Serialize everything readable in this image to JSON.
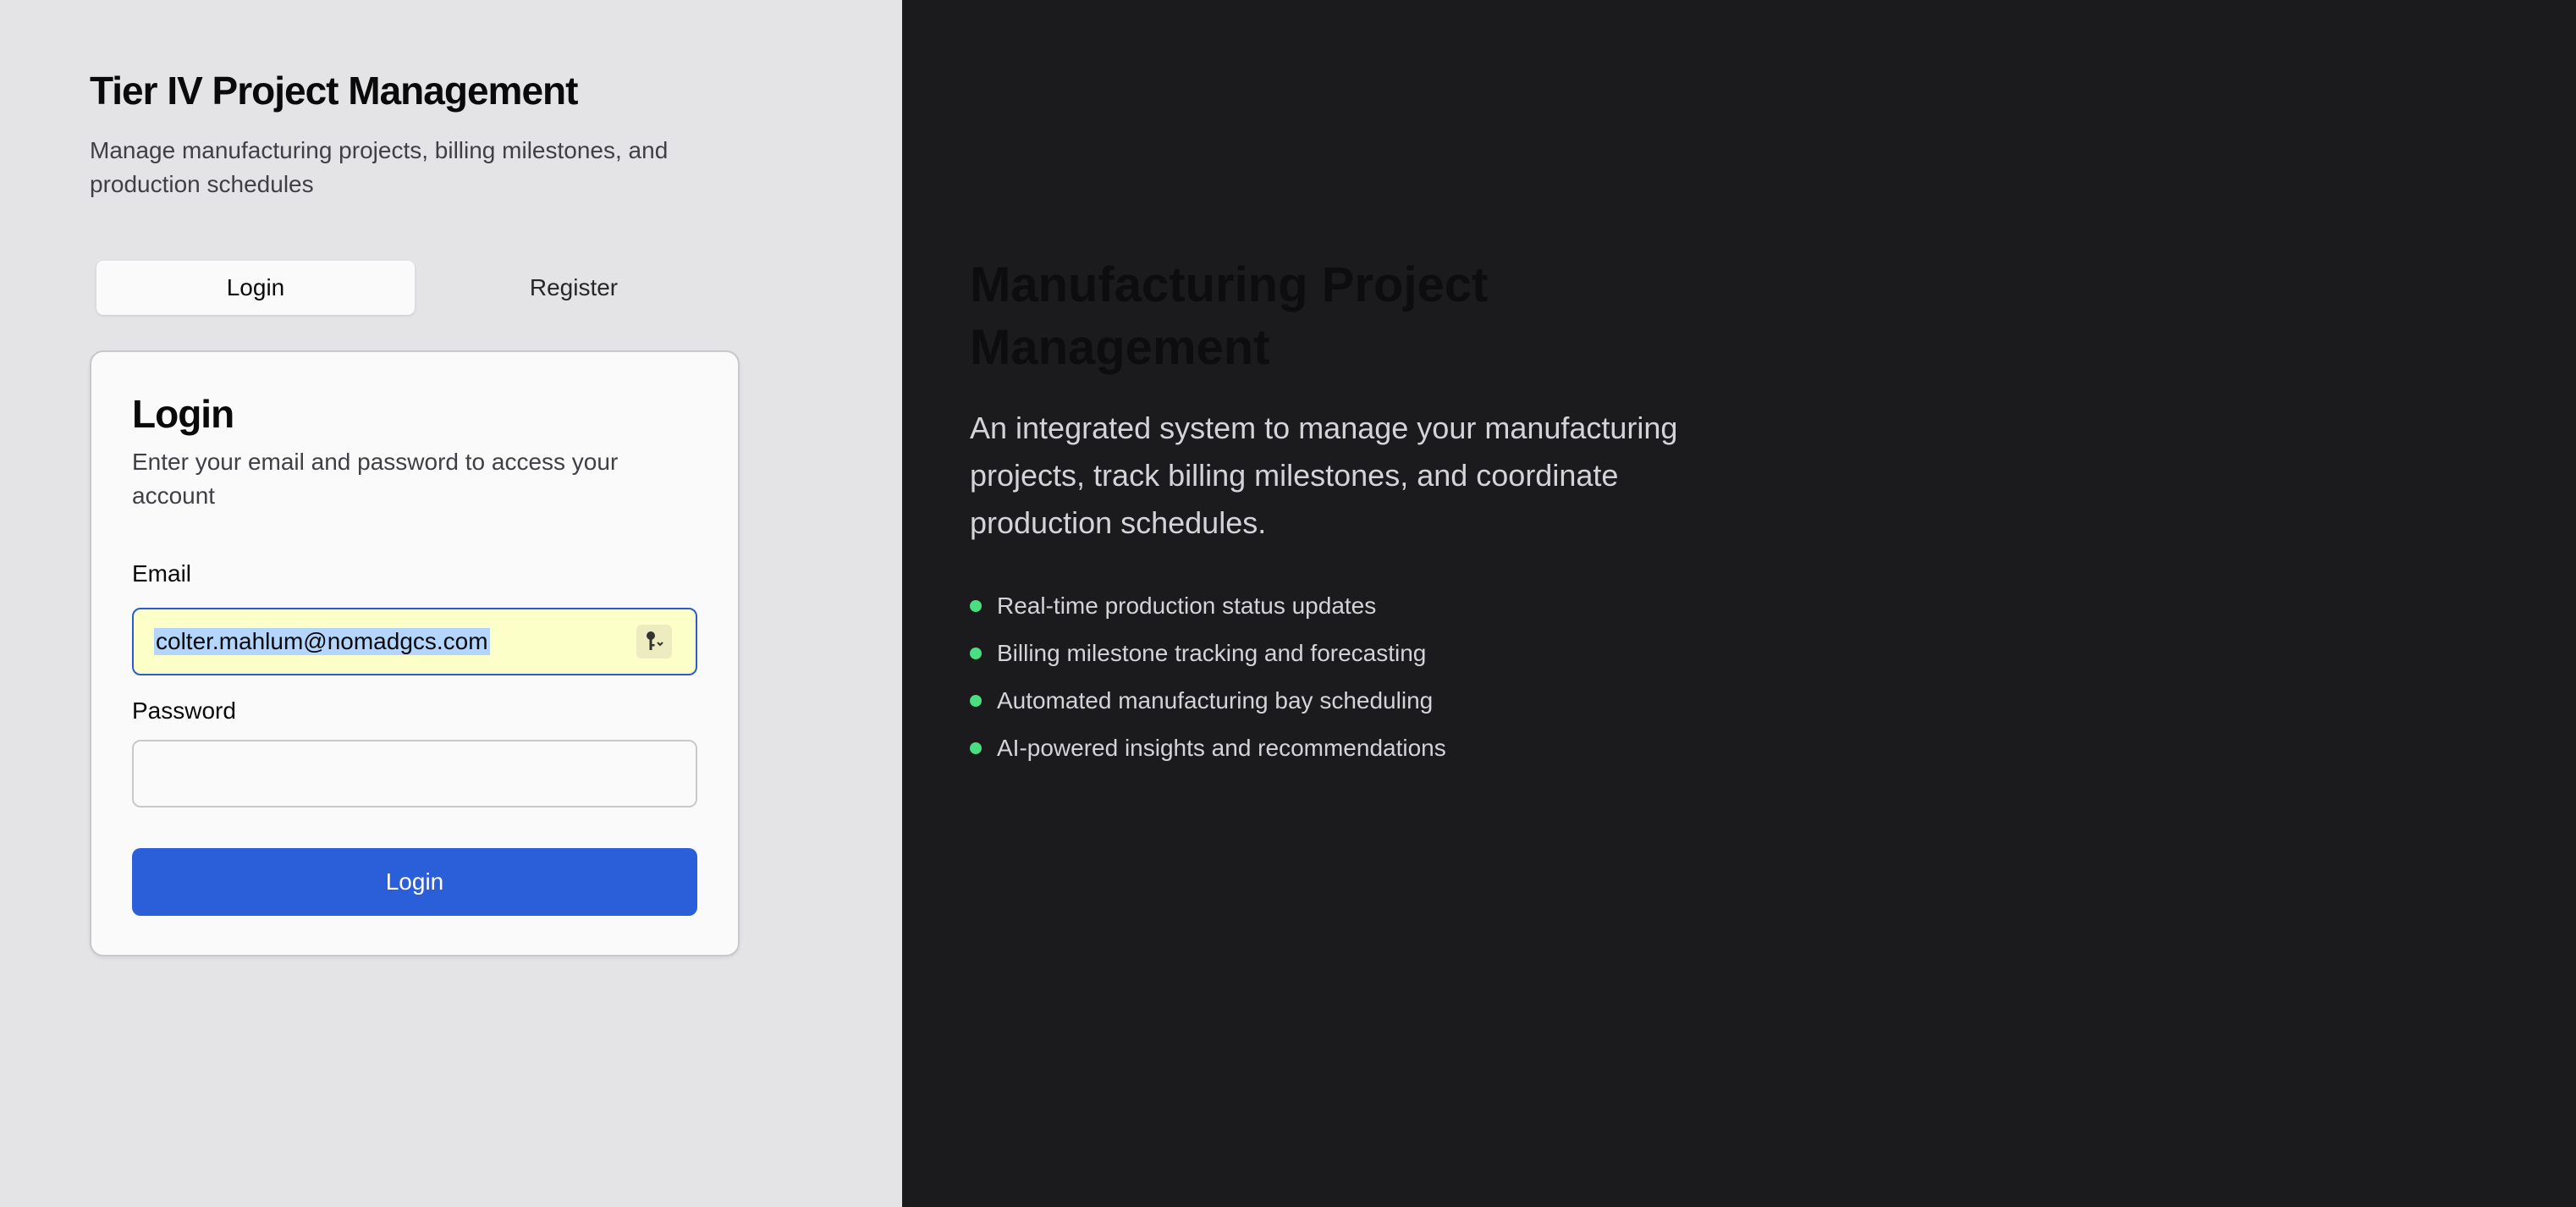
{
  "app": {
    "title": "Tier IV Project Management",
    "subtitle": "Manage manufacturing projects, billing milestones, and production schedules"
  },
  "tabs": [
    {
      "label": "Login",
      "active": true
    },
    {
      "label": "Register",
      "active": false
    }
  ],
  "login_card": {
    "title": "Login",
    "description": "Enter your email and password to access your account",
    "email_label": "Email",
    "email_value": "colter.mahlum@nomadgcs.com",
    "password_label": "Password",
    "password_value": "",
    "submit_label": "Login"
  },
  "hero": {
    "title": "Manufacturing Project Management",
    "description": "An integrated system to manage your manufacturing projects, track billing milestones, and coordinate production schedules.",
    "features": [
      "Real-time production status updates",
      "Billing milestone tracking and forecasting",
      "Automated manufacturing bay scheduling",
      "AI-powered insights and recommendations"
    ]
  },
  "colors": {
    "accent": "#2b5fd9",
    "left_bg": "#e4e4e7",
    "right_bg": "#1b1b1d",
    "bullet": "#4ade80",
    "autofill_bg": "#fdffc8"
  },
  "icons": {
    "password_manager": "key-icon"
  }
}
